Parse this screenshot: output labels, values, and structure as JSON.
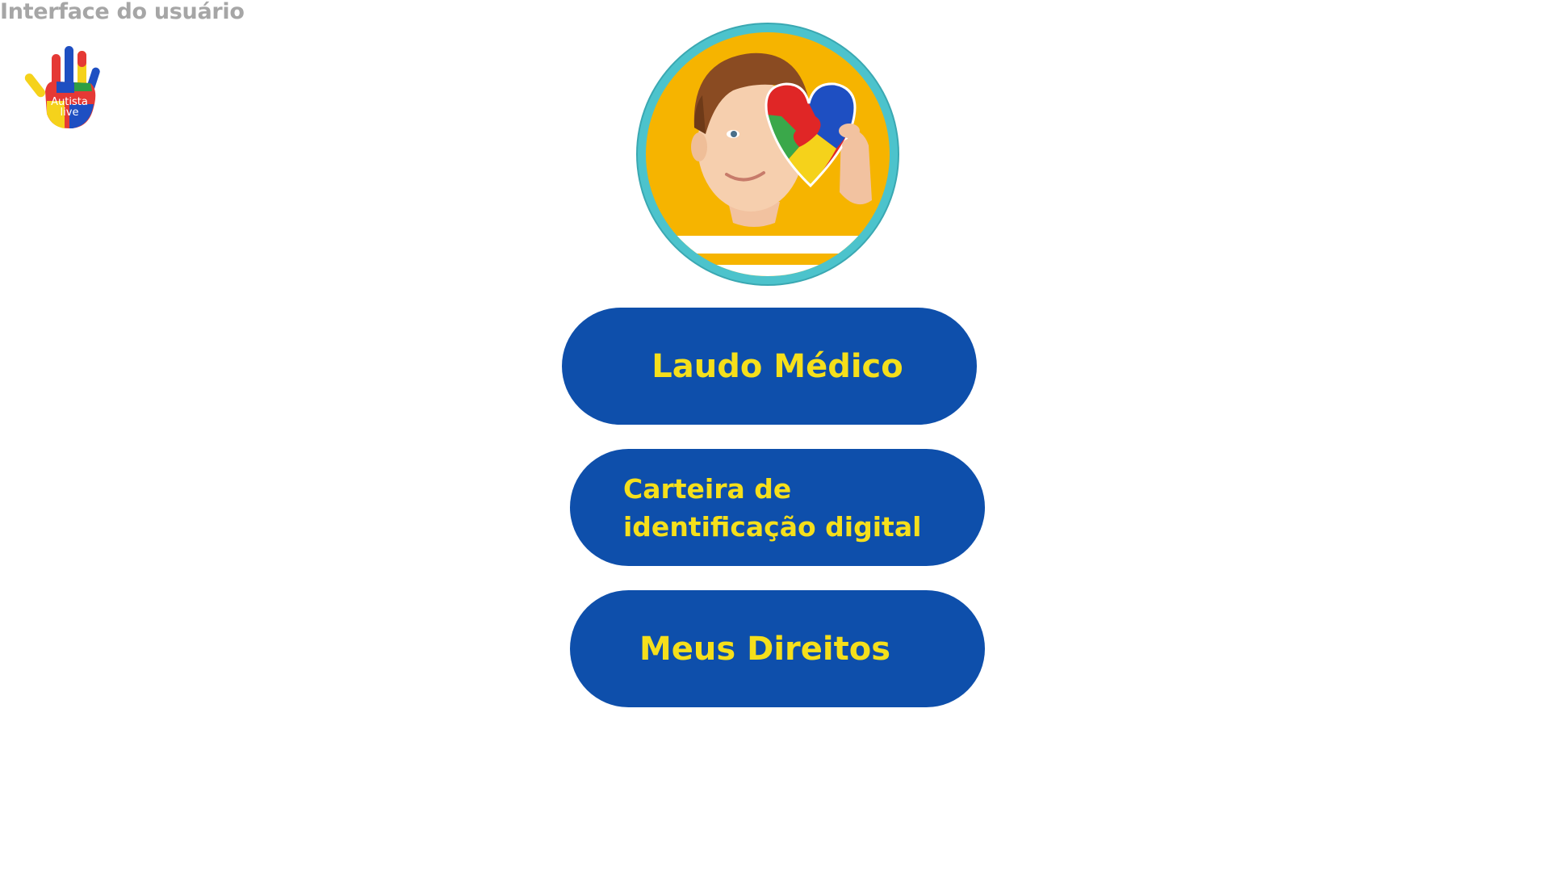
{
  "header": {
    "title": "Interface do usuário"
  },
  "logo": {
    "icon": "hand-puzzle-logo-icon",
    "line1": "Autista",
    "line2": "live",
    "colors": [
      "#e53935",
      "#1e4fc2",
      "#f5d21b",
      "#2e9e44"
    ]
  },
  "hero": {
    "icon": "child-with-puzzle-heart-photo",
    "border_color": "#4cc3cc",
    "background_color": "#f6b400"
  },
  "menu": {
    "button_color": "#0e4fab",
    "text_color": "#f5df1b",
    "items": [
      {
        "label": "Laudo Médico"
      },
      {
        "label": "Carteira de identificação digital"
      },
      {
        "label": "Meus Direitos"
      }
    ]
  }
}
